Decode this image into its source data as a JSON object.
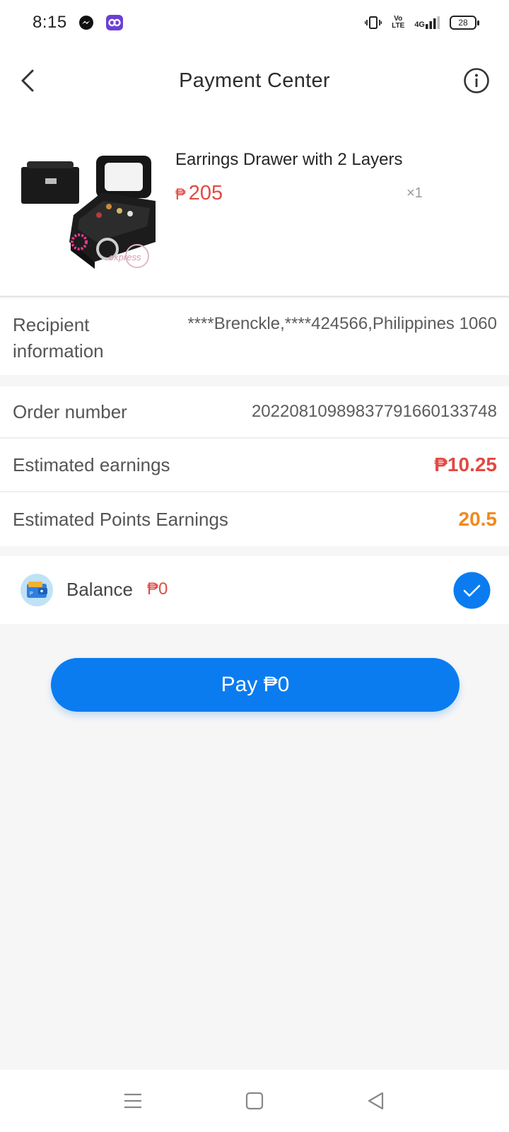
{
  "status_bar": {
    "time": "8:15",
    "network_lte_top": "Vo",
    "network_lte_bottom": "LTE",
    "network_gen": "4G",
    "battery": "28",
    "icons": [
      "messenger-icon",
      "app-icon",
      "vibrate-icon",
      "volte-icon",
      "signal-icon",
      "battery-icon"
    ]
  },
  "header": {
    "title": "Payment Center",
    "icons": [
      "back-arrow-icon",
      "info-icon"
    ]
  },
  "product": {
    "name": "Earrings Drawer with 2 Layers",
    "currency": "₱",
    "price": "205",
    "quantity": "×1",
    "image_watermark": "express"
  },
  "details": {
    "recipient_label": "Recipient information",
    "recipient_value": "****Brenckle,****424566,Philippines 1060",
    "order_label": "Order number",
    "order_value": "2022081098983779166013374­8",
    "earnings_label": "Estimated earnings",
    "earnings_value": "₱10.25",
    "points_label": "Estimated Points Earnings",
    "points_value": "20.5"
  },
  "payment": {
    "balance_label": "Balance",
    "balance_amount": "₱0",
    "pay_button": "Pay ₱0"
  },
  "colors": {
    "primary": "#0a7cf0",
    "price_red": "#e14a43",
    "points_orange": "#f08a1c",
    "background": "#f6f6f7"
  },
  "nav": {
    "icons": [
      "menu-icon",
      "home-square-icon",
      "back-triangle-icon"
    ]
  }
}
